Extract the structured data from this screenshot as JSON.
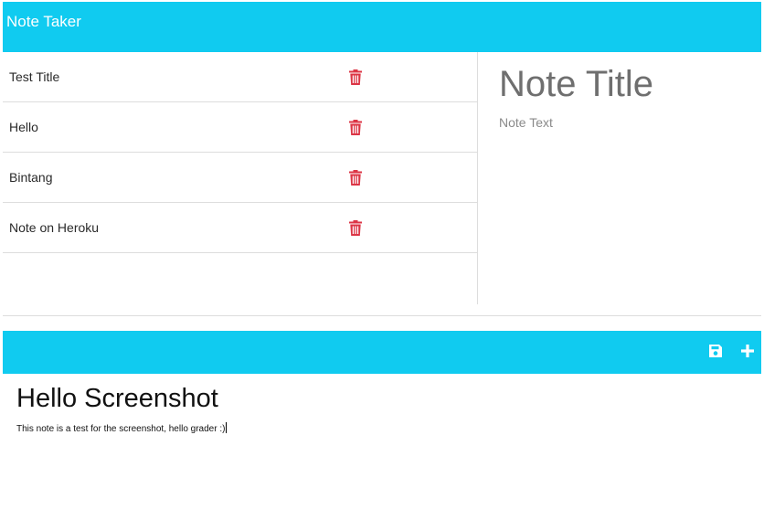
{
  "app": {
    "title": "Note Taker"
  },
  "notes_list": {
    "items": [
      {
        "label": "Test Title",
        "icon": "trash-icon"
      },
      {
        "label": "Hello",
        "icon": "trash-icon"
      },
      {
        "label": "Bintang",
        "icon": "trash-icon"
      },
      {
        "label": "Note on Heroku",
        "icon": "trash-icon"
      }
    ]
  },
  "editor": {
    "title_placeholder": "Note Title",
    "text_placeholder": "Note Text"
  },
  "toolbar": {
    "save_icon": "save-icon",
    "add_icon": "plus-icon"
  },
  "active_note": {
    "title": "Hello Screenshot",
    "text": "This note is a test for the screenshot, hello grader :)"
  },
  "colors": {
    "accent": "#10cbf0",
    "danger": "#dc3545",
    "divider": "#dddddd"
  }
}
